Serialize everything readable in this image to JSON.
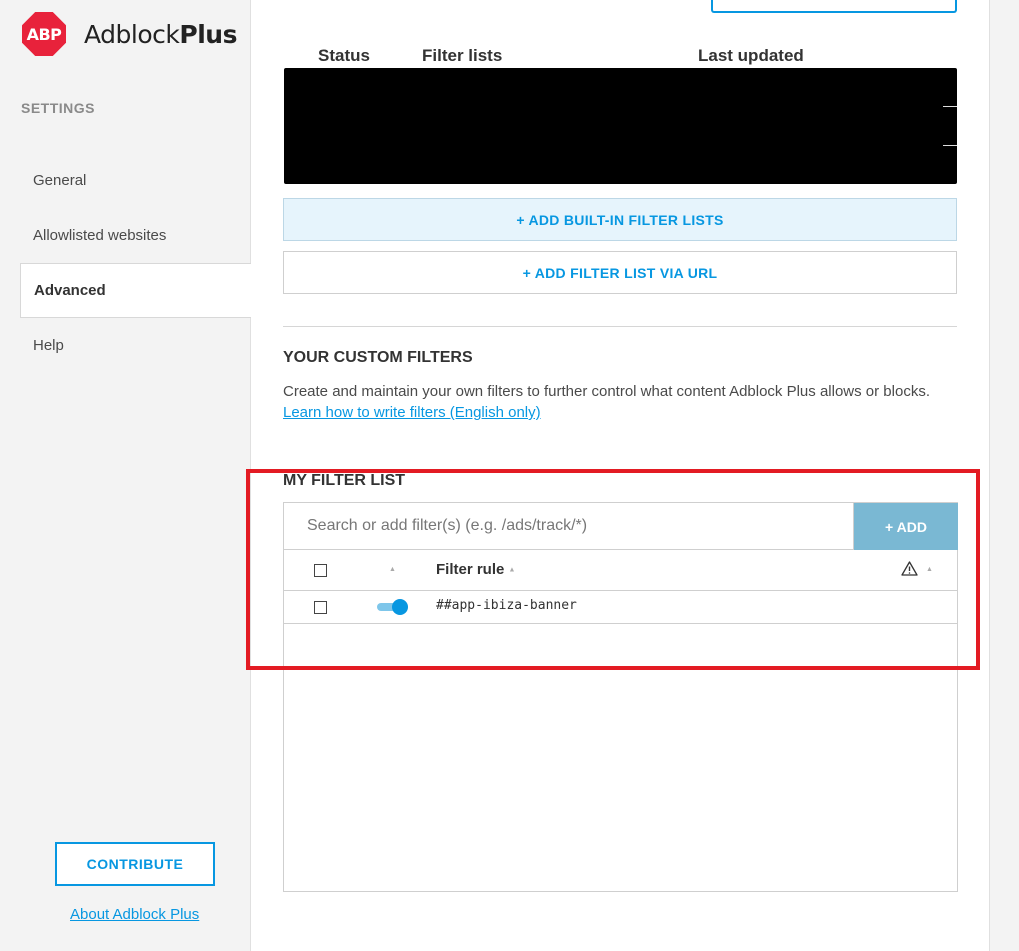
{
  "sidebar": {
    "logo": {
      "badge": "ABP",
      "name_regular": "Adblock",
      "name_bold": "Plus"
    },
    "heading": "SETTINGS",
    "items": [
      {
        "label": "General"
      },
      {
        "label": "Allowlisted websites"
      },
      {
        "label": "Advanced"
      },
      {
        "label": "Help"
      }
    ],
    "active_item": "Advanced",
    "contribute_label": "CONTRIBUTE",
    "about_label": "About Adblock Plus"
  },
  "filter_lists": {
    "columns": [
      "Status",
      "Filter lists",
      "Last updated"
    ],
    "add_builtin_label": "+ ADD BUILT-IN FILTER LISTS",
    "add_url_label": "+ ADD FILTER LIST VIA URL"
  },
  "custom_filters": {
    "title": "YOUR CUSTOM FILTERS",
    "description": "Create and maintain your own filters to further control what content Adblock Plus allows or blocks.",
    "link": "Learn how to write filters (English only)"
  },
  "my_filter_list": {
    "title": "MY FILTER LIST",
    "search_placeholder": "Search or add filter(s) (e.g. /ads/track/*)",
    "add_label": "+ ADD",
    "header_filter_rule": "Filter rule",
    "rows": [
      {
        "rule": "##app-ibiza-banner",
        "enabled": true,
        "selected": false
      }
    ]
  },
  "colors": {
    "accent": "#0797e1",
    "logo_red": "#e8223b",
    "highlight_red": "#e31b23"
  }
}
